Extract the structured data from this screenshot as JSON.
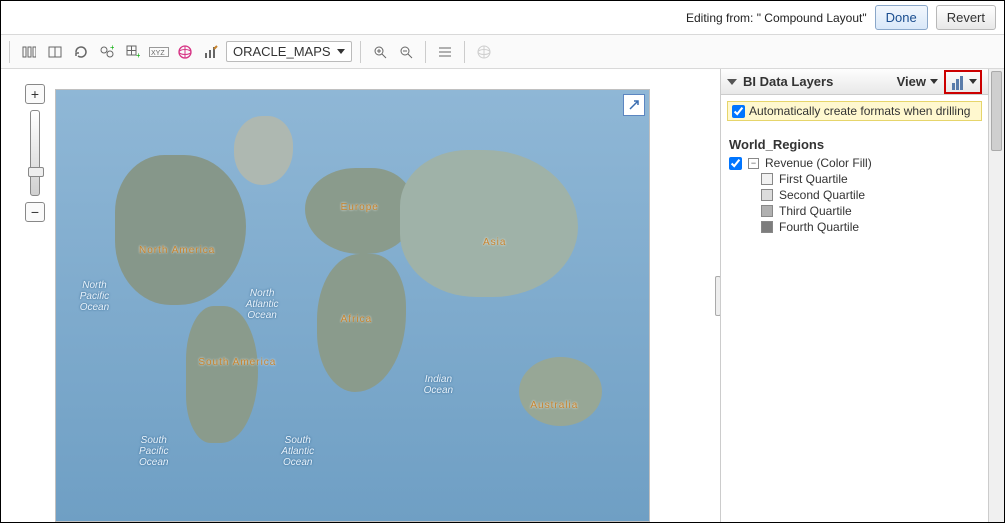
{
  "header": {
    "editing_from_label": "Editing from: \" Compound Layout\"",
    "done_label": "Done",
    "revert_label": "Revert"
  },
  "toolbar": {
    "map_select_label": "ORACLE_MAPS"
  },
  "panel": {
    "title": "BI Data Layers",
    "view_label": "View",
    "auto_format_label": "Automatically create formats when drilling",
    "layer_name": "World_Regions",
    "legend_title": "Revenue (Color Fill)",
    "legend_items": [
      {
        "label": "First Quartile",
        "color": "#f1f1f1"
      },
      {
        "label": "Second Quartile",
        "color": "#dcdcdc"
      },
      {
        "label": "Third Quartile",
        "color": "#b0b0b0"
      },
      {
        "label": "Fourth Quartile",
        "color": "#7d7d7d"
      }
    ]
  },
  "map": {
    "regions": {
      "north_america": "North America",
      "south_america": "South America",
      "europe": "Europe",
      "africa": "Africa",
      "asia": "Asia",
      "australia": "Australia"
    },
    "oceans": {
      "north_pacific": "North\nPacific\nOcean",
      "south_pacific": "South\nPacific\nOcean",
      "north_atlantic": "North\nAtlantic\nOcean",
      "south_atlantic": "South\nAtlantic\nOcean",
      "indian": "Indian\nOcean"
    }
  }
}
